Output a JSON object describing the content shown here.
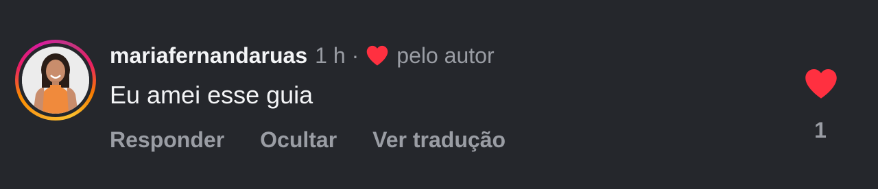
{
  "comment": {
    "username": "mariafernandaruas",
    "time_ago": "1 h",
    "separator": "·",
    "liked_by_author_label": "pelo autor",
    "text": "Eu amei esse guia",
    "like_count": "1"
  },
  "actions": {
    "reply": "Responder",
    "hide": "Ocultar",
    "translate": "Ver tradução"
  },
  "icons": {
    "author_heart": "heart-icon",
    "like_heart": "heart-icon"
  },
  "colors": {
    "background": "#25272c",
    "heart": "#ff3040",
    "primary_text": "#f3f4f6",
    "secondary_text": "#9a9da4"
  }
}
